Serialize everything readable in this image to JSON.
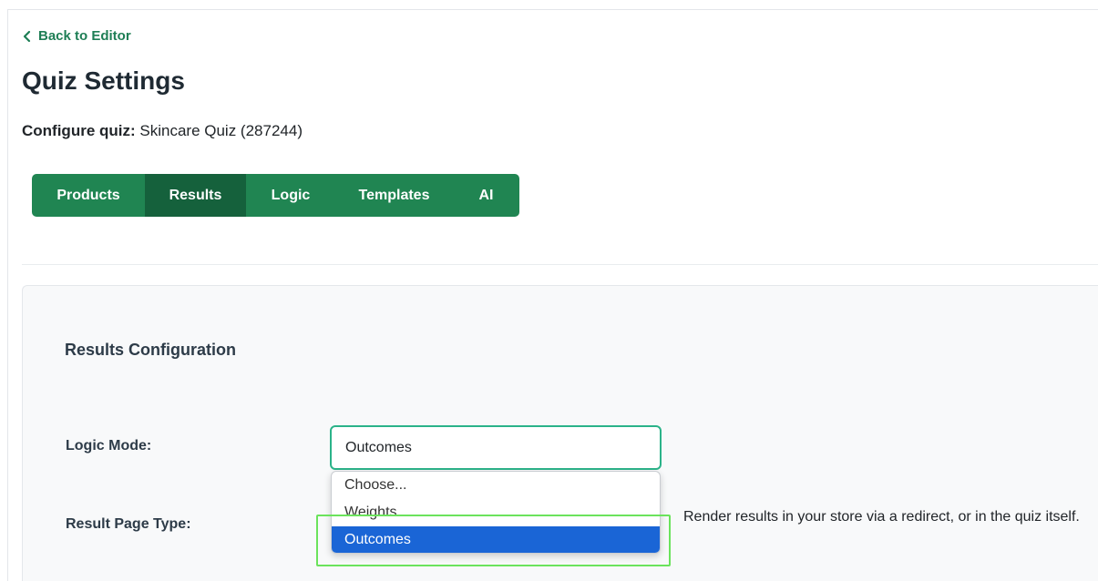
{
  "nav": {
    "back_label": "Back to Editor"
  },
  "page": {
    "title": "Quiz Settings",
    "configure_label": "Configure quiz:",
    "configure_value": "Skincare Quiz (287244)"
  },
  "tabs": [
    {
      "label": "Products",
      "active": false
    },
    {
      "label": "Results",
      "active": true
    },
    {
      "label": "Logic",
      "active": false
    },
    {
      "label": "Templates",
      "active": false
    },
    {
      "label": "AI",
      "active": false
    }
  ],
  "results": {
    "section_title": "Results Configuration",
    "logic_mode": {
      "label": "Logic Mode:",
      "value": "Outcomes",
      "options": [
        "Choose...",
        "Weights",
        "Outcomes"
      ],
      "highlighted_option": "Outcomes"
    },
    "result_page_type": {
      "label": "Result Page Type:",
      "help_text": "Render results in your store via a redirect, or in the quiz itself."
    }
  },
  "colors": {
    "brand_green": "#208552",
    "active_tab": "#15613c",
    "select_border": "#2bb389",
    "option_selected": "#1a65d6",
    "annotation_highlight": "#6be35c"
  },
  "icons": {
    "back": "chevron-left-icon"
  }
}
